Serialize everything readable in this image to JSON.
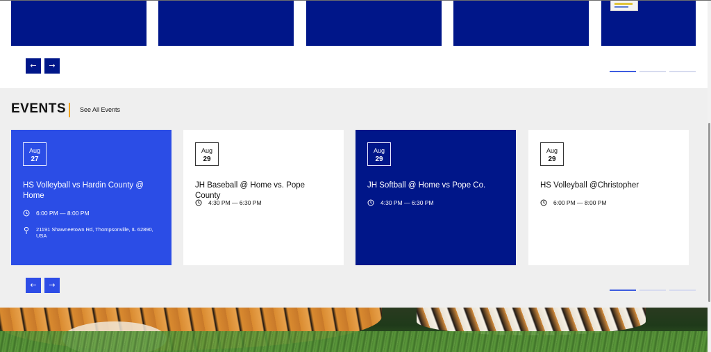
{
  "news_nav": {
    "prev_label": "←",
    "next_label": "→"
  },
  "events": {
    "heading": "EVENTS",
    "see_all": "See All Events",
    "items": [
      {
        "month": "Aug",
        "day": "27",
        "title": "HS Volleyball vs Hardin County @ Home",
        "time": "6:00 PM — 8:00 PM",
        "address": "21191 Shawneetown Rd, Thompsonville, IL 62890, USA"
      },
      {
        "month": "Aug",
        "day": "29",
        "title": "JH Baseball @ Home vs. Pope County",
        "time": "4:30 PM — 6:30 PM"
      },
      {
        "month": "Aug",
        "day": "29",
        "title": "JH Softball @ Home vs Pope Co.",
        "time": "4:30 PM — 6:30 PM"
      },
      {
        "month": "Aug",
        "day": "29",
        "title": "HS Volleyball @Christopher",
        "time": "6:00 PM — 8:00 PM"
      }
    ],
    "nav": {
      "prev_label": "←",
      "next_label": "→"
    }
  },
  "icons": {
    "clock": "clock-icon",
    "location": "map-pin-icon",
    "arrow_left": "arrow-left-icon",
    "arrow_right": "arrow-right-icon"
  },
  "colors": {
    "navy": "#001689",
    "blue": "#2b4de6",
    "accent": "#f0a31f",
    "background": "#efefef"
  }
}
